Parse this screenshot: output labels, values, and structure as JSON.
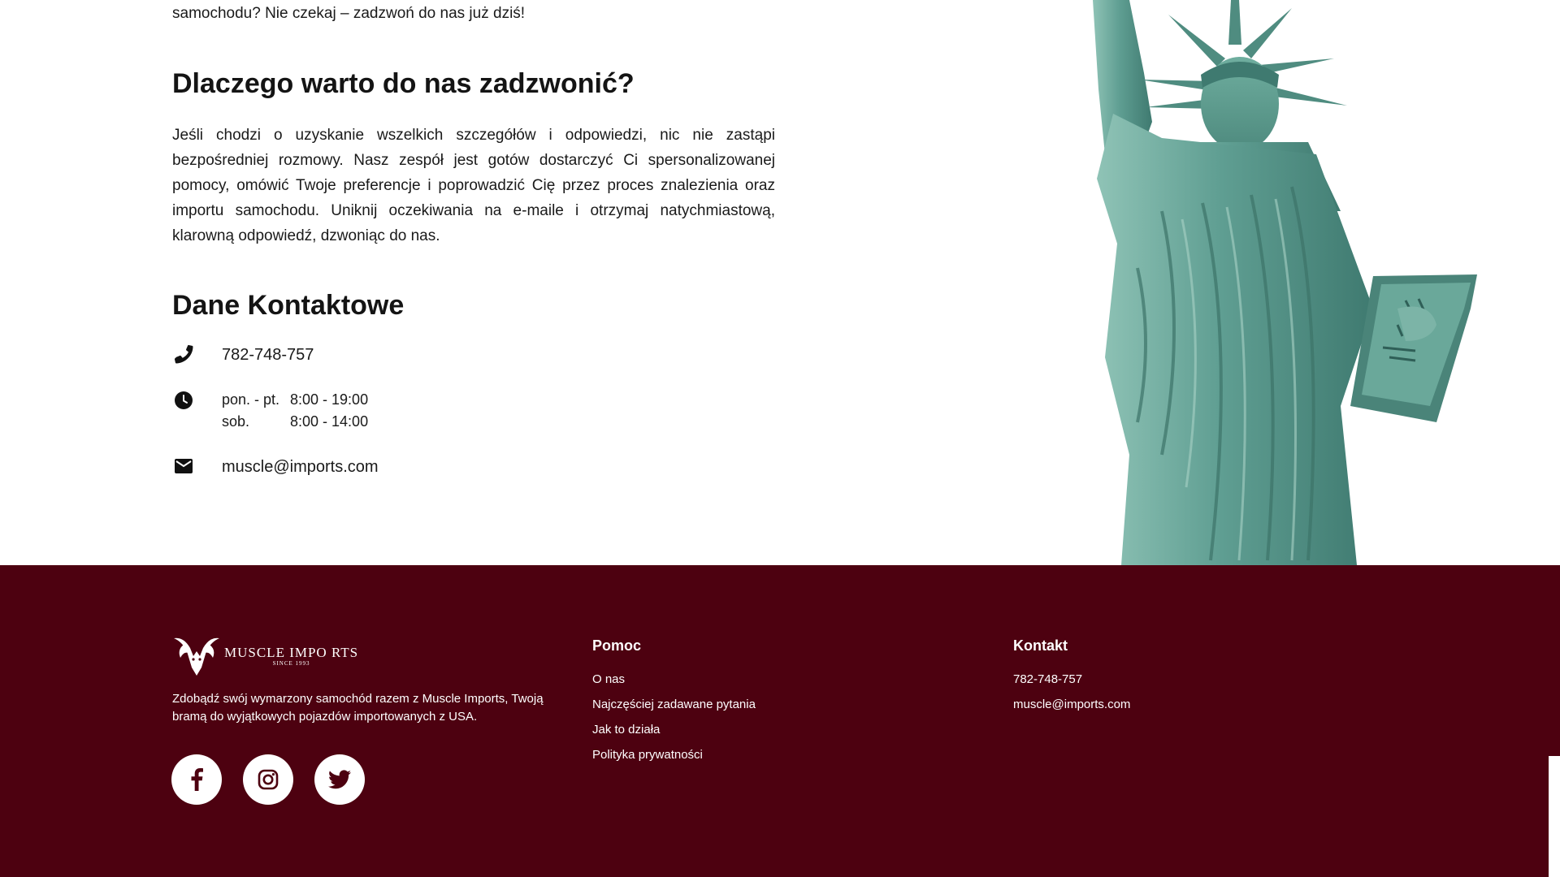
{
  "intro": {
    "tail_text": "samochodu? Nie czekaj – zadzwoń do nas już dziś!"
  },
  "why_call": {
    "heading": "Dlaczego warto do nas zadzwonić?",
    "paragraph": "Jeśli chodzi o uzyskanie wszelkich szczegółów i odpowiedzi, nic nie zastąpi bezpośredniej rozmowy. Nasz zespół jest gotów dostarczyć Ci spersonalizowanej pomocy, omówić Twoje preferencje i poprowadzić Cię przez proces znalezienia oraz importu samochodu. Uniknij oczekiwania na e-maile i otrzymaj natychmiastową, klarowną odpowiedź, dzwoniąc do nas."
  },
  "contact_details": {
    "heading": "Dane Kontaktowe",
    "phone": "782-748-757",
    "hours": [
      {
        "day": "pon. - pt.",
        "time": "8:00 - 19:00"
      },
      {
        "day": "sob.",
        "time": "8:00 - 14:00"
      }
    ],
    "email": "muscle@imports.com",
    "icons": {
      "phone": "phone-icon",
      "hours": "clock-icon",
      "email": "mail-icon"
    }
  },
  "footer": {
    "brand": {
      "name": "MUSCLE IMPO RTS",
      "since": "SINCE 1993"
    },
    "about": "Zdobądź swój wymarzony samochód razem z Muscle Imports, Twoją bramą do wyjątkowych pojazdów importowanych z USA.",
    "socials": [
      "facebook-icon",
      "instagram-icon",
      "twitter-icon"
    ],
    "help": {
      "title": "Pomoc",
      "links": [
        "O nas",
        "Najczęściej zadawane pytania",
        "Jak to działa",
        "Polityka prywatności"
      ]
    },
    "contact": {
      "title": "Kontakt",
      "phone": "782-748-757",
      "email": "muscle@imports.com"
    }
  },
  "colors": {
    "footer_background": "#4d0110",
    "text": "#1a1a1a",
    "statue": "#5f9e92"
  }
}
